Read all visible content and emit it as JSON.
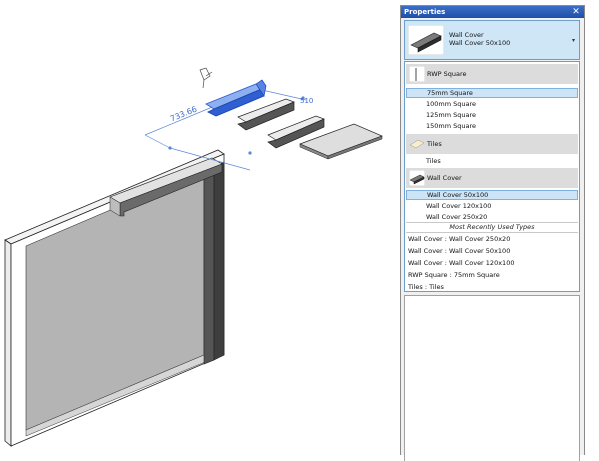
{
  "palette": {
    "title_bar": "#2c5fb8",
    "selection": "#cde4f7",
    "selection_border": "#7fb1e0",
    "family_header": "#dcdcdc",
    "wall_face": "#b4b4b4",
    "dimension": "#5b88d8"
  },
  "viewport": {
    "dimension_1": "733.66",
    "dimension_2": "510",
    "pin_icon": "pin-icon"
  },
  "properties": {
    "title": "Properties",
    "close_glyph": "✕",
    "type_selector": {
      "family": "Wall Cover",
      "type": "Wall Cover 50x100",
      "caret": "▾",
      "thumb_icon": "wall-cover-profile-icon"
    },
    "families": [
      {
        "name": "RWP Square",
        "icon": "rwp-square-icon",
        "types": [
          "75mm Square",
          "100mm Square",
          "125mm Square",
          "150mm Square"
        ],
        "selected_index": 0
      },
      {
        "name": "Tiles",
        "icon": "tiles-icon",
        "types": [
          "Tiles"
        ],
        "selected_index": -1
      },
      {
        "name": "Wall Cover",
        "icon": "wall-cover-icon",
        "types": [
          "Wall Cover 50x100",
          "Wall Cover 120x100",
          "Wall Cover 250x20"
        ],
        "selected_index": 0
      }
    ],
    "mru_title": "Most Recently Used Types",
    "mru": [
      "Wall Cover : Wall Cover 250x20",
      "Wall Cover : Wall Cover 50x100",
      "Wall Cover : Wall Cover 120x100",
      "RWP Square : 75mm Square",
      "Tiles : Tiles"
    ]
  }
}
